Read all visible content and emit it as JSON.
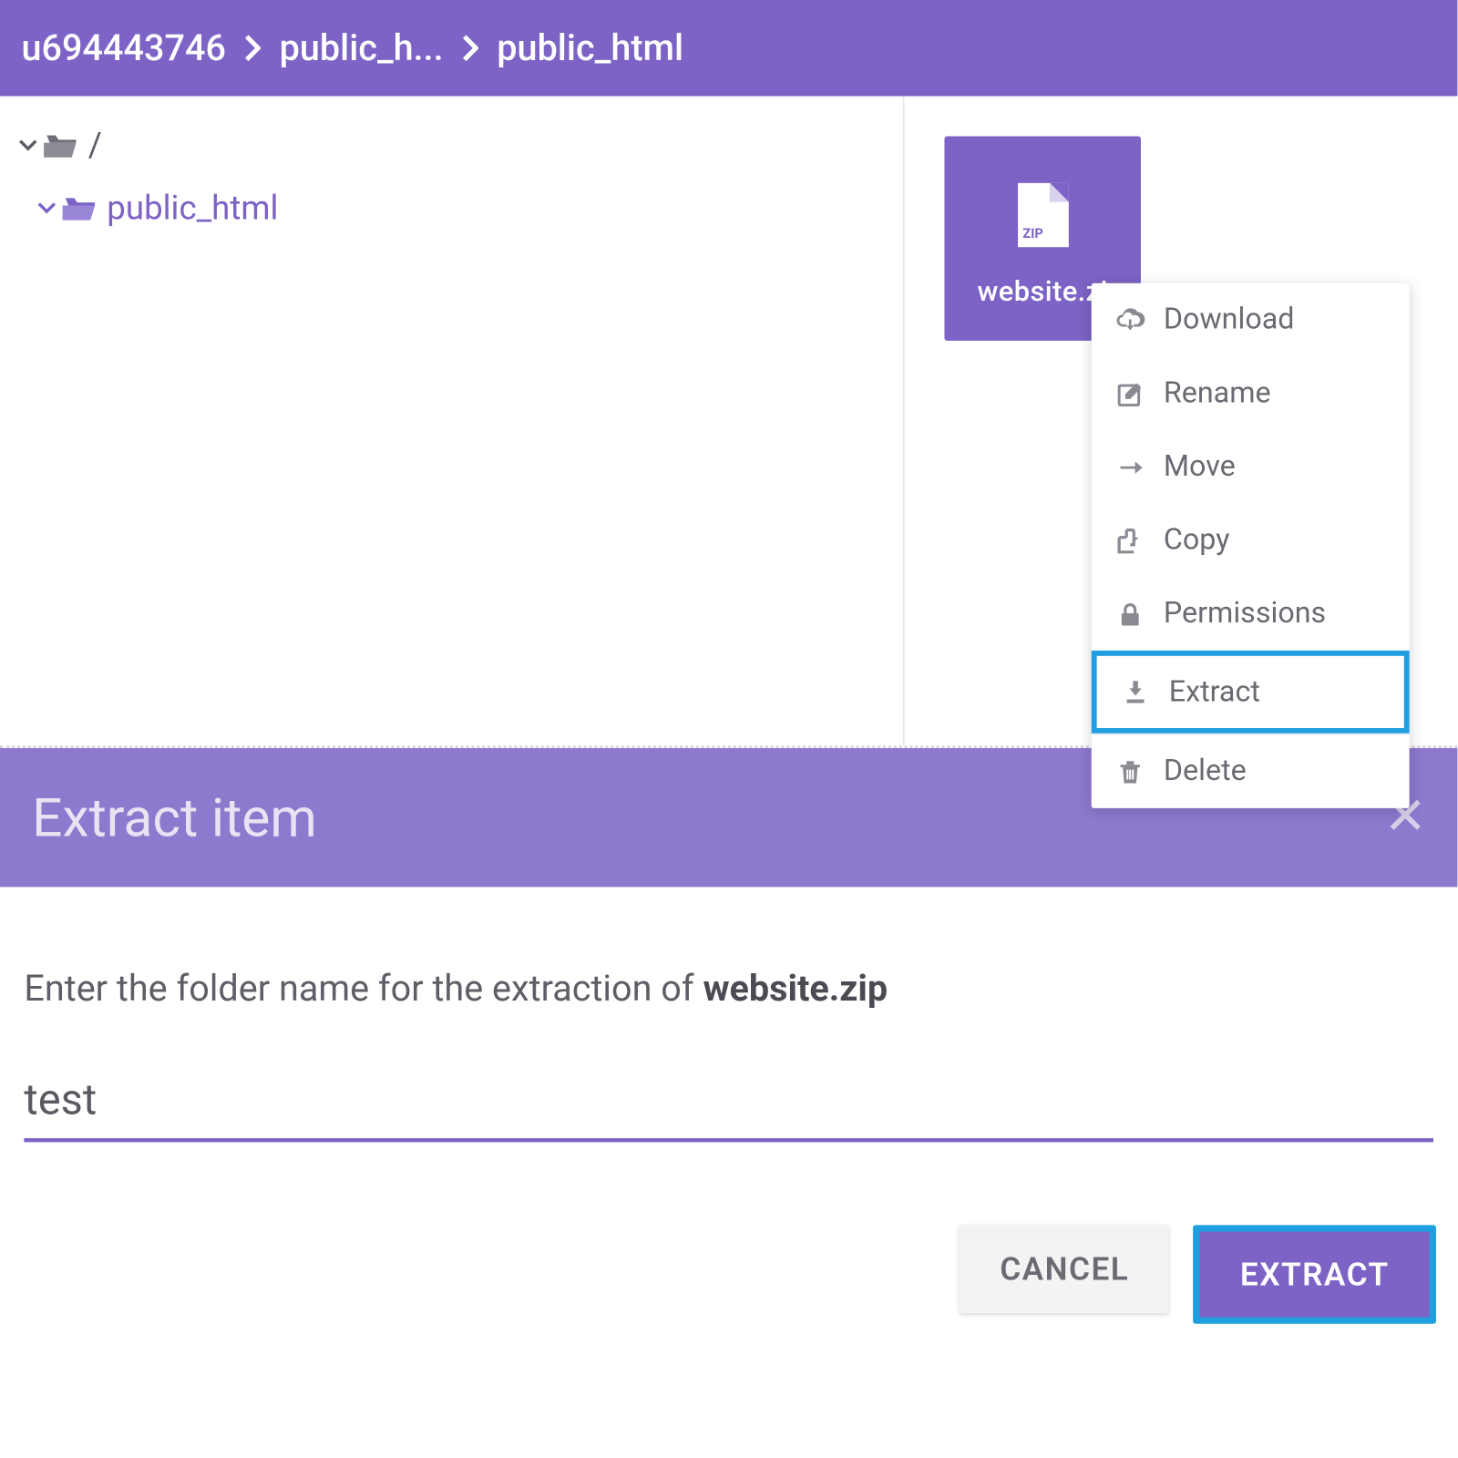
{
  "breadcrumb": {
    "items": [
      "u694443746",
      "public_h...",
      "public_html"
    ]
  },
  "sidebar": {
    "root_label": "/",
    "child_label": "public_html"
  },
  "file": {
    "name": "website.zi",
    "badge": "ZIP"
  },
  "context_menu": {
    "items": [
      {
        "icon": "download-icon",
        "label": "Download"
      },
      {
        "icon": "rename-icon",
        "label": "Rename"
      },
      {
        "icon": "move-icon",
        "label": "Move"
      },
      {
        "icon": "copy-icon",
        "label": "Copy"
      },
      {
        "icon": "permissions-icon",
        "label": "Permissions"
      },
      {
        "icon": "extract-icon",
        "label": "Extract",
        "highlighted": true
      },
      {
        "icon": "delete-icon",
        "label": "Delete"
      }
    ]
  },
  "dialog": {
    "title": "Extract item",
    "prompt_prefix": "Enter the folder name for the extraction of ",
    "prompt_filename": "website.zip",
    "input_value": "test",
    "cancel_label": "CANCEL",
    "extract_label": "EXTRACT"
  }
}
